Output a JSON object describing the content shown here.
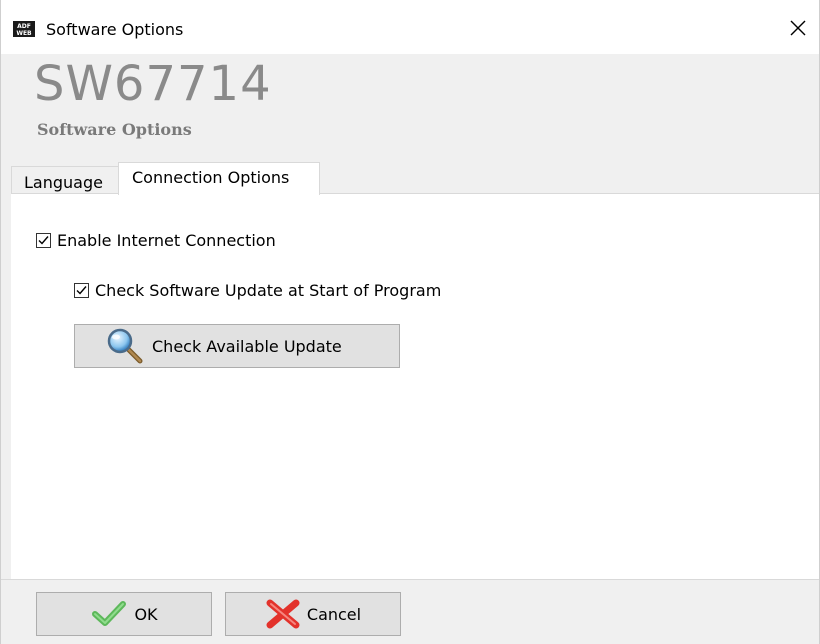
{
  "window": {
    "title": "Software Options",
    "app_icon": "adfweb-logo-icon",
    "close_icon": "close-icon"
  },
  "header": {
    "product_code": "SW67714",
    "subtitle": "Software Options"
  },
  "tabs": [
    {
      "label": "Language",
      "selected": false
    },
    {
      "label": "Connection Options",
      "selected": true
    }
  ],
  "connection": {
    "enable_internet_label": "Enable Internet Connection",
    "enable_internet_checked": true,
    "check_update_start_label": "Check Software Update at Start of Program",
    "check_update_start_checked": true,
    "check_update_button_label": "Check Available Update",
    "check_update_button_icon": "magnifier-icon"
  },
  "footer": {
    "ok_label": "OK",
    "ok_icon": "checkmark-icon",
    "cancel_label": "Cancel",
    "cancel_icon": "x-icon"
  },
  "colors": {
    "window_bg": "#f0f0f0",
    "panel_bg": "#ffffff",
    "product_code": "#8a8a8a",
    "ok_green": "#5db85b",
    "cancel_red": "#e3322b"
  }
}
